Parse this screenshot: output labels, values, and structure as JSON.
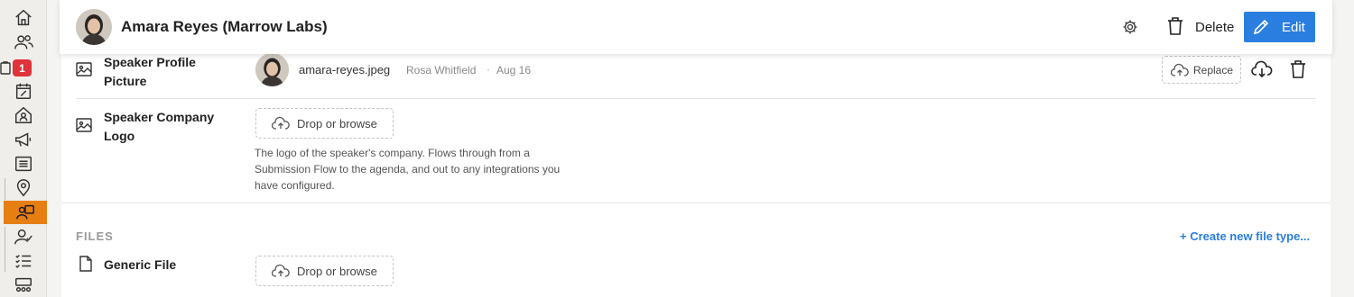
{
  "header": {
    "title": "Amara Reyes (Marrow Labs)",
    "delete_label": "Delete",
    "edit_label": "Edit"
  },
  "sidebar": {
    "badge_count": "1",
    "items": [
      "home-icon",
      "people-icon",
      "tasks-badge",
      "calendar-icon",
      "venue-icon",
      "megaphone-icon",
      "list-icon",
      "location-icon",
      "speakers-icon",
      "attendee-check-icon",
      "checklist-icon",
      "seating-icon"
    ],
    "active_color": "#e67e12"
  },
  "rows": {
    "profile_picture": {
      "label": "Speaker Profile Picture",
      "filename": "amara-reyes.jpeg",
      "uploader": "Rosa Whitfield",
      "separator": "·",
      "date": "Aug 16",
      "replace_label": "Replace"
    },
    "company_logo": {
      "label": "Speaker Company Logo",
      "drop_label": "Drop or browse",
      "help_text": "The logo of the speaker's company. Flows through from a Submission Flow to the agenda, and out to any integrations you have configured."
    }
  },
  "files": {
    "section_title": "FILES",
    "create_link": "+ Create new file type...",
    "generic_file": {
      "label": "Generic File",
      "drop_label": "Drop or browse"
    }
  },
  "colors": {
    "accent": "#2a7ee0",
    "badge": "#e0323a"
  }
}
